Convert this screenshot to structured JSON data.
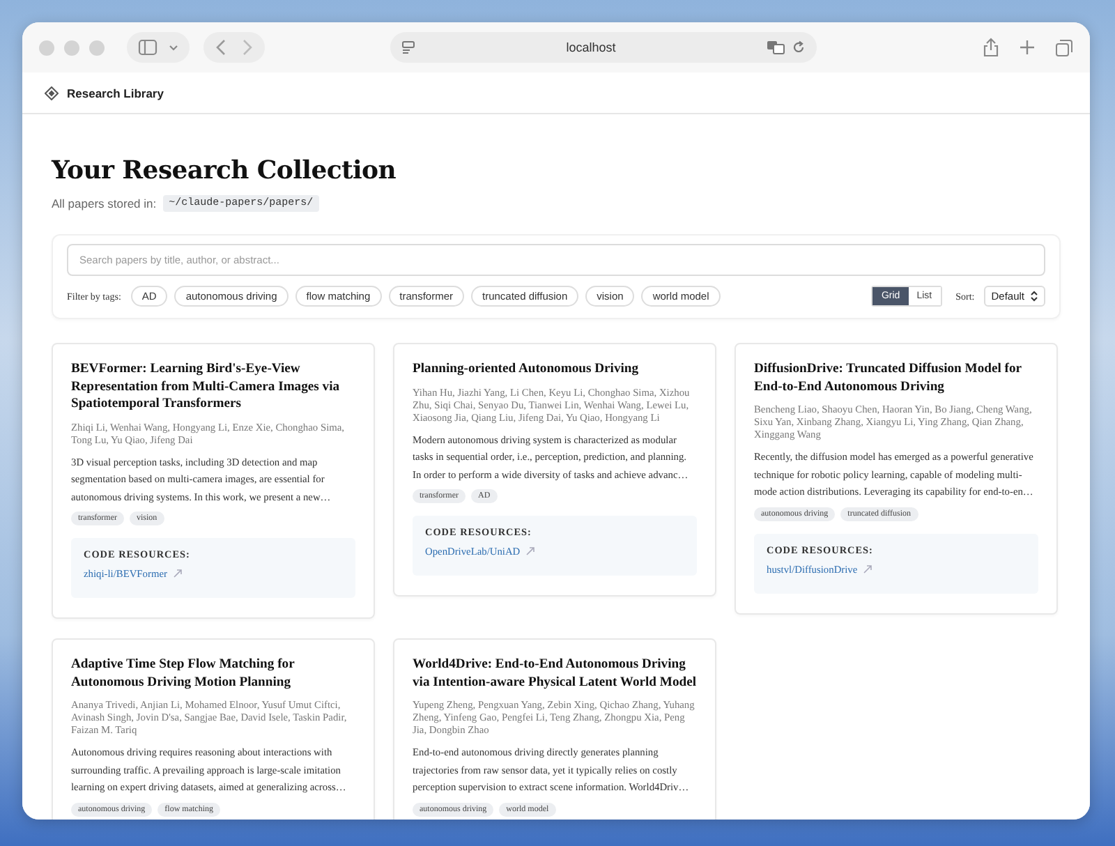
{
  "browser": {
    "url": "localhost"
  },
  "app": {
    "brand": "Research Library"
  },
  "header": {
    "title": "Your Research Collection",
    "stored_label": "All papers stored in:",
    "path": "~/claude-papers/papers/"
  },
  "search": {
    "placeholder": "Search papers by title, author, or abstract..."
  },
  "filter": {
    "label": "Filter by tags:",
    "tags": [
      "AD",
      "autonomous driving",
      "flow matching",
      "transformer",
      "truncated diffusion",
      "vision",
      "world model"
    ]
  },
  "view_modes": [
    {
      "label": "Grid",
      "selected": true
    },
    {
      "label": "List",
      "selected": false
    }
  ],
  "sort": {
    "label": "Sort:",
    "value": "Default"
  },
  "papers": [
    {
      "title": "BEVFormer: Learning Bird's-Eye-View Representation from Multi-Camera Images via Spatiotemporal Transformers",
      "authors": "Zhiqi Li, Wenhai Wang, Hongyang Li, Enze Xie, Chonghao Sima, Tong Lu, Yu Qiao, Jifeng Dai",
      "abstract": "3D visual perception tasks, including 3D detection and map segmentation based on multi-camera images, are essential for autonomous driving systems. In this work, we present a new…",
      "tags": [
        "transformer",
        "vision"
      ],
      "code": {
        "label": "CODE RESOURCES:",
        "link": "zhiqi-li/BEVFormer"
      }
    },
    {
      "title": "Planning-oriented Autonomous Driving",
      "authors": "Yihan Hu, Jiazhi Yang, Li Chen, Keyu Li, Chonghao Sima, Xizhou Zhu, Siqi Chai, Senyao Du, Tianwei Lin, Wenhai Wang, Lewei Lu, Xiaosong Jia, Qiang Liu, Jifeng Dai, Yu Qiao, Hongyang Li",
      "abstract": "Modern autonomous driving system is characterized as modular tasks in sequential order, i.e., perception, prediction, and planning. In order to perform a wide diversity of tasks and achieve advanc…",
      "tags": [
        "transformer",
        "AD"
      ],
      "code": {
        "label": "CODE RESOURCES:",
        "link": "OpenDriveLab/UniAD"
      }
    },
    {
      "title": "DiffusionDrive: Truncated Diffusion Model for End-to-End Autonomous Driving",
      "authors": "Bencheng Liao, Shaoyu Chen, Haoran Yin, Bo Jiang, Cheng Wang, Sixu Yan, Xinbang Zhang, Xiangyu Li, Ying Zhang, Qian Zhang, Xinggang Wang",
      "abstract": "Recently, the diffusion model has emerged as a powerful generative technique for robotic policy learning, capable of modeling multi-mode action distributions. Leveraging its capability for end-to-en…",
      "tags": [
        "autonomous driving",
        "truncated diffusion"
      ],
      "code": {
        "label": "CODE RESOURCES:",
        "link": "hustvl/DiffusionDrive"
      }
    },
    {
      "title": "Adaptive Time Step Flow Matching for Autonomous Driving Motion Planning",
      "authors": "Ananya Trivedi, Anjian Li, Mohamed Elnoor, Yusuf Umut Ciftci, Avinash Singh, Jovin D'sa, Sangjae Bae, David Isele, Taskin Padir, Faizan M. Tariq",
      "abstract": "Autonomous driving requires reasoning about interactions with surrounding traffic. A prevailing approach is large-scale imitation learning on expert driving datasets, aimed at generalizing across…",
      "tags": [
        "autonomous driving",
        "flow matching"
      ]
    },
    {
      "title": "World4Drive: End-to-End Autonomous Driving via Intention-aware Physical Latent World Model",
      "authors": "Yupeng Zheng, Pengxuan Yang, Zebin Xing, Qichao Zhang, Yuhang Zheng, Yinfeng Gao, Pengfei Li, Teng Zhang, Zhongpu Xia, Peng Jia, Dongbin Zhao",
      "abstract": "End-to-end autonomous driving directly generates planning trajectories from raw sensor data, yet it typically relies on costly perception supervision to extract scene information. World4Driv…",
      "tags": [
        "autonomous driving",
        "world model"
      ]
    }
  ]
}
